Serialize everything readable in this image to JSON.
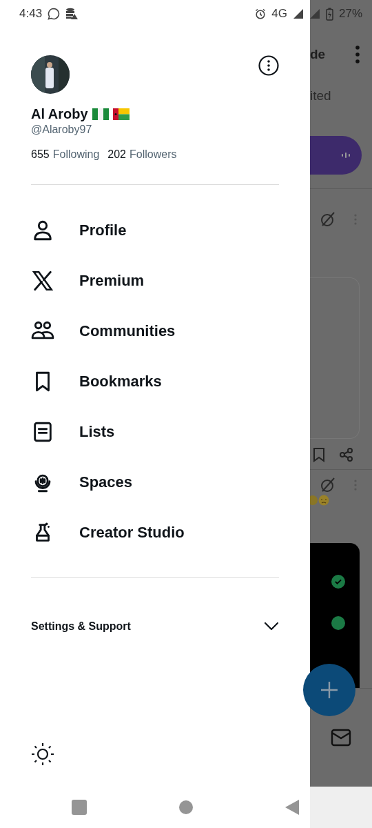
{
  "status_bar": {
    "time": "4:43",
    "network": "4G",
    "battery": "27%"
  },
  "profile": {
    "name": "Al Aroby",
    "handle": "@Alaroby97",
    "following_count": "655",
    "following_label": "Following",
    "followers_count": "202",
    "followers_label": "Followers"
  },
  "menu": [
    {
      "label": "Profile",
      "kind": "profile"
    },
    {
      "label": "Premium",
      "kind": "premium"
    },
    {
      "label": "Communities",
      "kind": "communities"
    },
    {
      "label": "Bookmarks",
      "kind": "bookmarks"
    },
    {
      "label": "Lists",
      "kind": "lists"
    },
    {
      "label": "Spaces",
      "kind": "spaces"
    },
    {
      "label": "Creator Studio",
      "kind": "studio"
    }
  ],
  "settings": {
    "label": "Settings & Support",
    "expanded": false
  },
  "background": {
    "title_fragment": "de",
    "tab_fragment": "ited"
  }
}
